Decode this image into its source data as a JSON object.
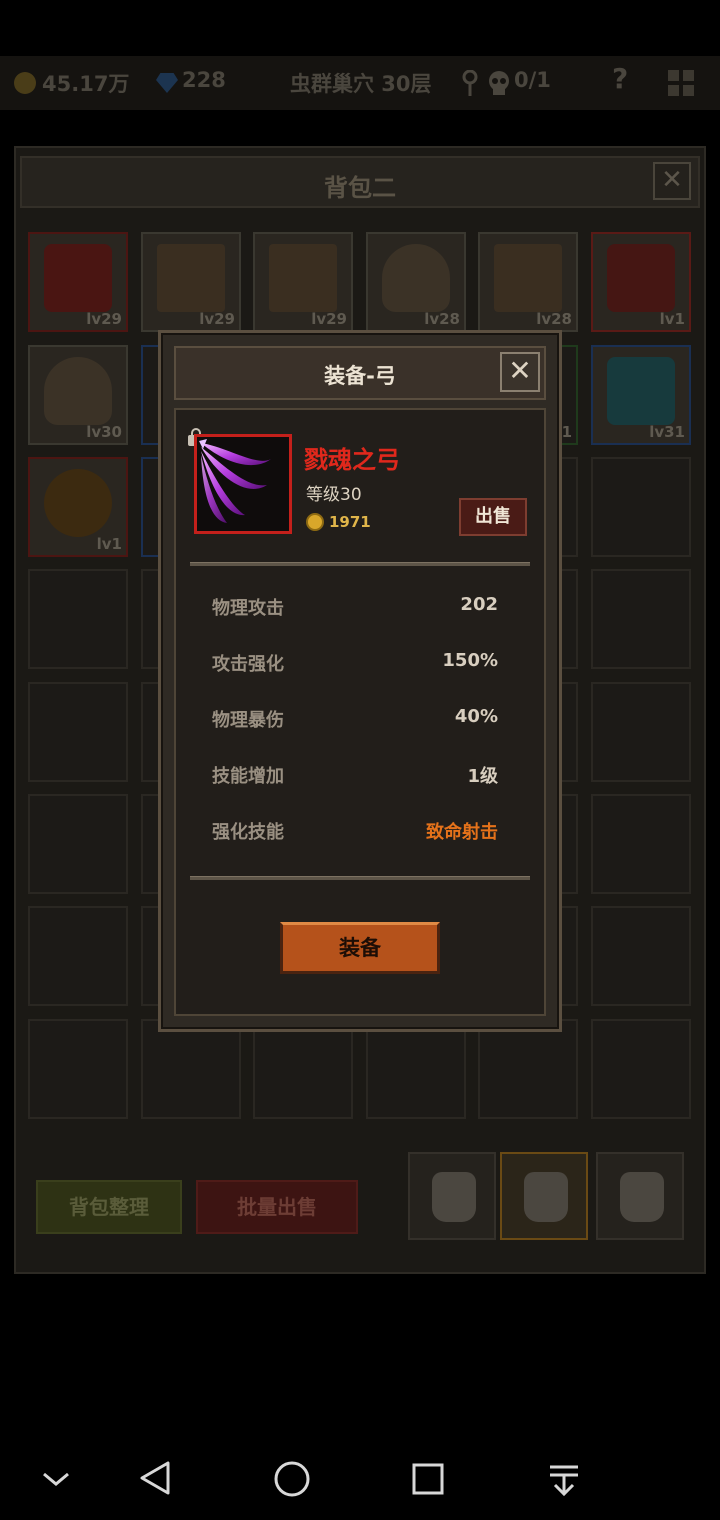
{
  "hud": {
    "gold": "45.17万",
    "gems": "228",
    "location": "虫群巢穴 30层",
    "keys": "0/1",
    "help": "?"
  },
  "bag": {
    "title": "背包二",
    "close_label": "✕",
    "slots": [
      {
        "level": "lv29",
        "kind": "armor"
      },
      {
        "level": "lv29",
        "kind": "shield"
      },
      {
        "level": "lv29",
        "kind": "shield"
      },
      {
        "level": "lv28",
        "kind": "helmet"
      },
      {
        "level": "lv28",
        "kind": "shield"
      },
      {
        "level": "lv1",
        "kind": "staff"
      },
      {
        "level": "lv30",
        "kind": "helmet"
      },
      {
        "level": "1",
        "kind": "bow"
      },
      {
        "level": "lv31",
        "kind": "staff"
      },
      {
        "level": "lv1",
        "kind": "amulet"
      }
    ],
    "sort_label": "背包整理",
    "batch_sell_label": "批量出售"
  },
  "modal": {
    "title": "装备-弓",
    "close_label": "✕",
    "item": {
      "name": "戮魂之弓",
      "level": "等级30",
      "price": "1971",
      "sell_label": "出售"
    },
    "stats": [
      {
        "label": "物理攻击",
        "value": "202"
      },
      {
        "label": "攻击强化",
        "value": "150%"
      },
      {
        "label": "物理暴伤",
        "value": "40%"
      },
      {
        "label": "技能增加",
        "value": "1级"
      },
      {
        "label": "强化技能",
        "value": "致命射击"
      }
    ],
    "equip_label": "装备"
  },
  "colors": {
    "item_name": "#e0281c",
    "skill_highlight": "#e5721a",
    "equip_button": "#b5521b",
    "sell_button": "#4a1b16"
  }
}
